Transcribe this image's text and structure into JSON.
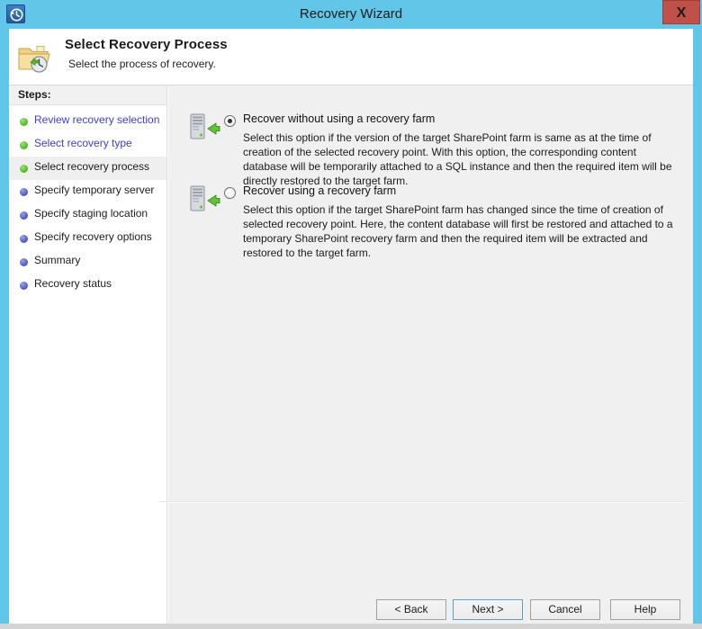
{
  "window": {
    "title": "Recovery Wizard",
    "icon": "recovery-clock-icon",
    "close_label": "X",
    "accent_color": "#62c6e8",
    "close_color": "#c0504a"
  },
  "header": {
    "icon": "folder-restore-icon",
    "title": "Select Recovery Process",
    "subtitle": "Select the process of recovery."
  },
  "sidebar": {
    "header_label": "Steps:",
    "items": [
      {
        "label": "Review recovery selection",
        "state": "done",
        "bullet": "green-bullet-icon",
        "is_link": true,
        "current": false
      },
      {
        "label": "Select recovery type",
        "state": "done",
        "bullet": "green-bullet-icon",
        "is_link": true,
        "current": false
      },
      {
        "label": "Select recovery process",
        "state": "current",
        "bullet": "green-bullet-icon",
        "is_link": false,
        "current": true
      },
      {
        "label": "Specify temporary server",
        "state": "pending",
        "bullet": "blue-bullet-icon",
        "is_link": false,
        "current": false
      },
      {
        "label": "Specify staging location",
        "state": "pending",
        "bullet": "blue-bullet-icon",
        "is_link": false,
        "current": false
      },
      {
        "label": "Specify recovery options",
        "state": "pending",
        "bullet": "blue-bullet-icon",
        "is_link": false,
        "current": false
      },
      {
        "label": "Summary",
        "state": "pending",
        "bullet": "blue-bullet-icon",
        "is_link": false,
        "current": false
      },
      {
        "label": "Recovery status",
        "state": "pending",
        "bullet": "blue-bullet-icon",
        "is_link": false,
        "current": false
      }
    ],
    "done_color": "#5cc22e",
    "pending_color": "#5b63c9",
    "link_color": "#3c3cd8"
  },
  "main": {
    "options": [
      {
        "icon": "server-restore-icon",
        "title": "Recover without using a recovery farm",
        "description": "Select this option if the version of the target SharePoint farm is same as at the time of creation of the selected recovery point. With this option, the corresponding content database will be temporarily attached to a SQL instance and then the required item will be directly restored to the target farm.",
        "selected": true
      },
      {
        "icon": "server-restore-icon",
        "title": "Recover using a recovery farm",
        "description": "Select this option if the target SharePoint farm has changed since the time of creation of selected recovery point. Here, the content database will first be restored and attached to a temporary SharePoint recovery farm and then the required item will be extracted and restored to the target farm.",
        "selected": false
      }
    ]
  },
  "footer": {
    "buttons": [
      {
        "label": "< Back",
        "name": "back-button",
        "default": false
      },
      {
        "label": "Next >",
        "name": "next-button",
        "default": true
      },
      {
        "label": "Cancel",
        "name": "cancel-button",
        "default": false
      },
      {
        "label": "Help",
        "name": "help-button",
        "default": false
      }
    ]
  }
}
